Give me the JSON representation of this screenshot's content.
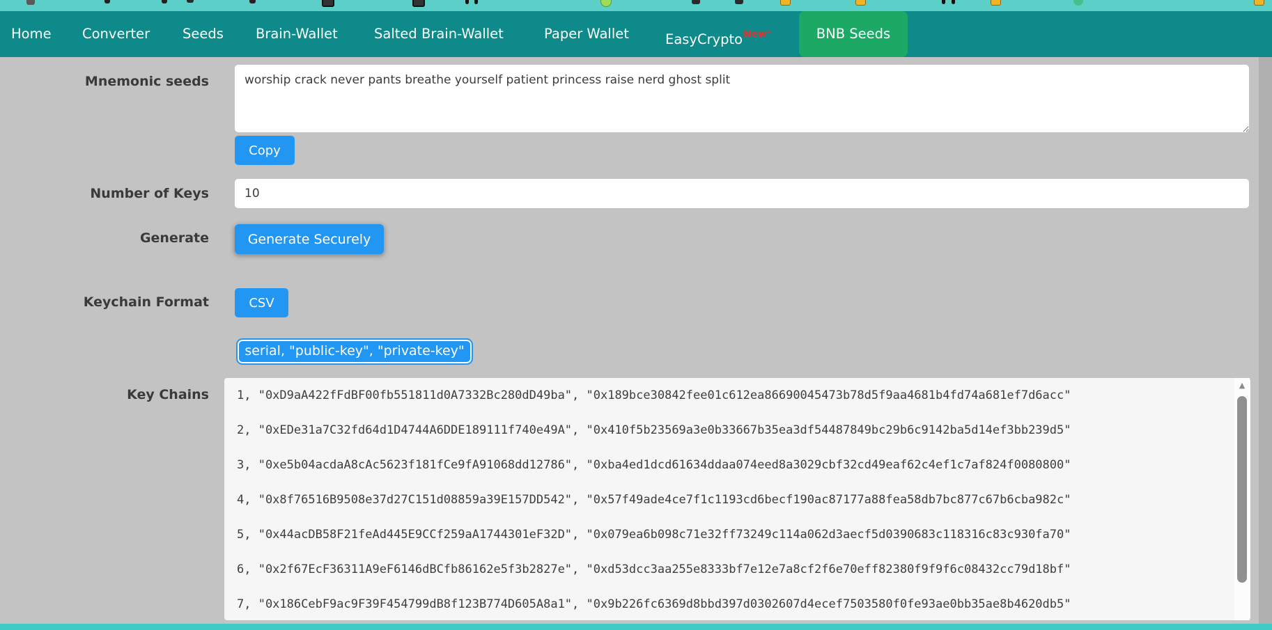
{
  "colors": {
    "accent_blue": "#2196f3",
    "nav_teal": "#0e8a8a",
    "active_tab_green": "#1ca966",
    "top_strip_teal": "#5ccfc9",
    "bottom_strip_teal": "#40cbc6",
    "page_background": "#c3c3c3"
  },
  "nav": {
    "items": [
      {
        "label": "Home"
      },
      {
        "label": "Converter"
      },
      {
        "label": "Seeds"
      },
      {
        "label": "Brain-Wallet"
      },
      {
        "label": "Salted Brain-Wallet"
      },
      {
        "label": "Paper Wallet"
      },
      {
        "label": "EasyCrypto",
        "badge": "New*"
      },
      {
        "label": "BNB Seeds",
        "active": true
      }
    ]
  },
  "form": {
    "mnemonic": {
      "label": "Mnemonic seeds",
      "value": "worship crack never pants breathe yourself patient princess raise nerd ghost split",
      "copy_button": "Copy"
    },
    "number_of_keys": {
      "label": "Number of Keys",
      "value": "10"
    },
    "generate": {
      "label": "Generate",
      "button": "Generate Securely"
    },
    "keychain_format": {
      "label": "Keychain Format",
      "csv_button": "CSV",
      "format_template": "serial, \"public-key\", \"private-key\""
    },
    "key_chains": {
      "label": "Key Chains",
      "rows": [
        "1, \"0xD9aA422fFdBF00fb551811d0A7332Bc280dD49ba\", \"0x189bce30842fee01c612ea86690045473b78d5f9aa4681b4fd74a681ef7d6acc\"",
        "2, \"0xEDe31a7C32fd64d1D4744A6DDE189111f740e49A\", \"0x410f5b23569a3e0b33667b35ea3df54487849bc29b6c9142ba5d14ef3bb239d5\"",
        "3, \"0xe5b04acdaA8cAc5623f181fCe9fA91068dd12786\", \"0xba4ed1dcd61634ddaa074eed8a3029cbf32cd49eaf62c4ef1c7af824f0080800\"",
        "4, \"0x8f76516B9508e37d27C151d08859a39E157DD542\", \"0x57f49ade4ce7f1c1193cd6becf190ac87177a88fea58db7bc877c67b6cba982c\"",
        "5, \"0x44acDB58F21feAd445E9CCf259aA1744301eF32D\", \"0x079ea6b098c71e32ff73249c114a062d3aecf5d0390683c118316c83c930fa70\"",
        "6, \"0x2f67EcF36311A9eF6146dBCfb86162e5f3b2827e\", \"0xd53dcc3aa255e8333bf7e12e7a8cf2f6e70eff82380f9f9f6c08432cc79d18bf\"",
        "7, \"0x186CebF9ac9F39F454799dB8f123B774D605A8a1\", \"0x9b226fc6369d8bbd397d0302607d4ecef7503580f0fe93ae0bb35ae8b4620db5\""
      ]
    }
  }
}
